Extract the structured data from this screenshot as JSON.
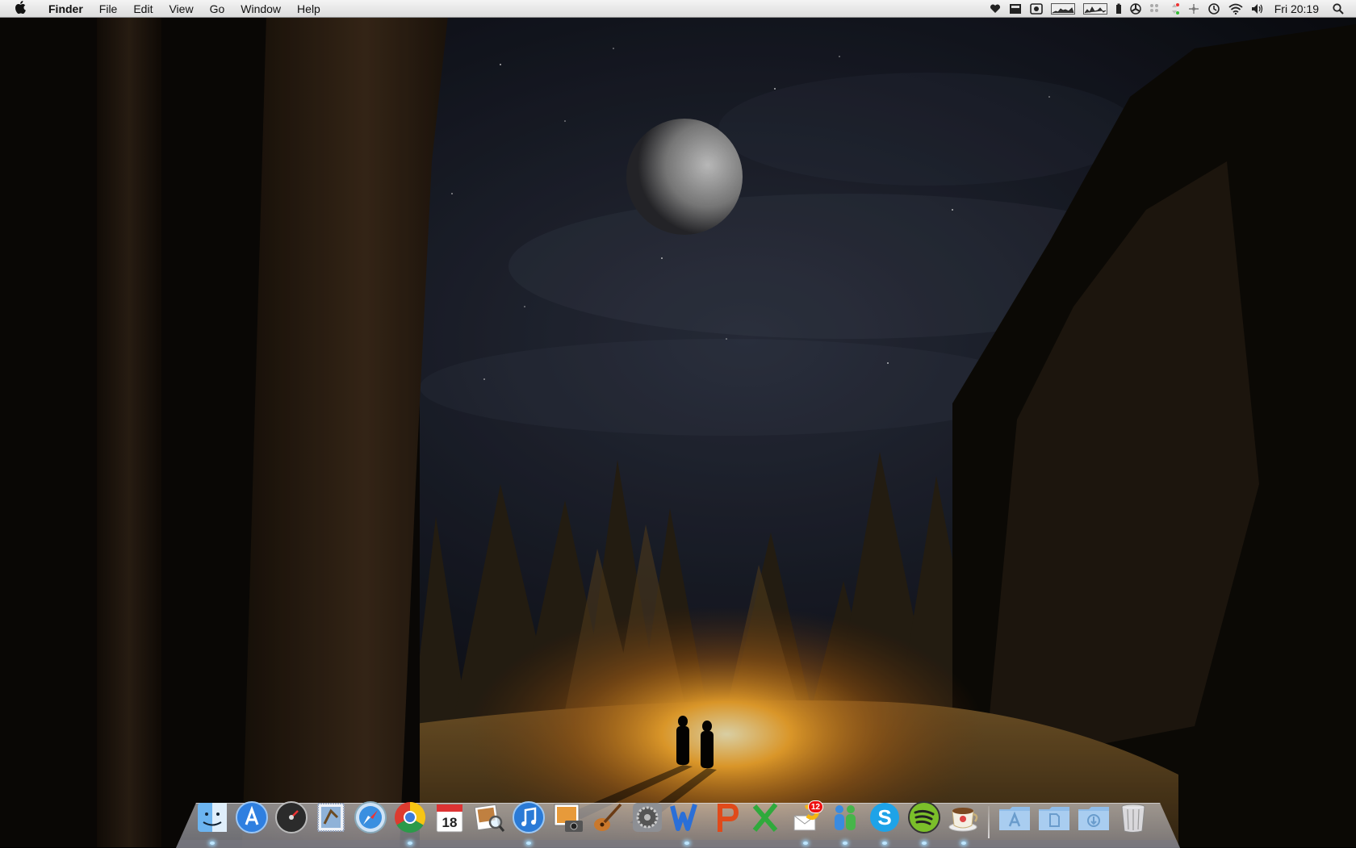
{
  "menubar": {
    "apple_icon": "apple-logo",
    "app_name": "Finder",
    "menus": [
      "File",
      "Edit",
      "View",
      "Go",
      "Window",
      "Help"
    ],
    "status_icons": [
      "heart-icon",
      "display-icon",
      "screen-capture-icon",
      "cpu-graph-icon",
      "network-graph-icon",
      "battery-icon",
      "fan-icon",
      "bluetooth-dots-icon",
      "stepper-icon",
      "scroll-icon",
      "time-machine-icon",
      "wifi-icon",
      "volume-icon"
    ],
    "clock": "Fri 20:19",
    "spotlight_icon": "spotlight-search-icon"
  },
  "wallpaper": {
    "description_colors": {
      "sky": "#161a26",
      "fire": "#ffb030",
      "snow": "#7a5a2a"
    }
  },
  "dock": {
    "apps": [
      {
        "name": "Finder",
        "icon": "finder-icon",
        "running": true
      },
      {
        "name": "App Store",
        "icon": "app-store-icon",
        "running": false
      },
      {
        "name": "Dashboard",
        "icon": "dashboard-icon",
        "running": false
      },
      {
        "name": "Mail",
        "icon": "mail-stamp-icon",
        "running": false
      },
      {
        "name": "Safari",
        "icon": "safari-icon",
        "running": false
      },
      {
        "name": "Google Chrome",
        "icon": "chrome-icon",
        "running": true
      },
      {
        "name": "iCal",
        "icon": "calendar-icon",
        "running": false,
        "date": "18"
      },
      {
        "name": "Preview",
        "icon": "preview-icon",
        "running": false
      },
      {
        "name": "iTunes",
        "icon": "itunes-icon",
        "running": true
      },
      {
        "name": "iPhoto",
        "icon": "iphoto-icon",
        "running": false
      },
      {
        "name": "GarageBand",
        "icon": "garageband-icon",
        "running": false
      },
      {
        "name": "System Preferences",
        "icon": "system-preferences-icon",
        "running": false
      },
      {
        "name": "Word",
        "icon": "word-icon",
        "running": true
      },
      {
        "name": "PowerPoint",
        "icon": "powerpoint-icon",
        "running": false
      },
      {
        "name": "Excel",
        "icon": "excel-icon",
        "running": false
      },
      {
        "name": "Sparrow",
        "icon": "sparrow-mail-icon",
        "running": true,
        "badge": "12"
      },
      {
        "name": "Messenger",
        "icon": "messenger-icon",
        "running": true
      },
      {
        "name": "Skype",
        "icon": "skype-icon",
        "running": true
      },
      {
        "name": "Spotify",
        "icon": "spotify-icon",
        "running": true
      },
      {
        "name": "Caffeine",
        "icon": "caffeine-cup-icon",
        "running": true
      }
    ],
    "stacks": [
      {
        "name": "Applications",
        "icon": "applications-folder-icon"
      },
      {
        "name": "Documents",
        "icon": "documents-folder-icon"
      },
      {
        "name": "Downloads",
        "icon": "downloads-folder-icon"
      },
      {
        "name": "Trash",
        "icon": "trash-icon"
      }
    ]
  }
}
